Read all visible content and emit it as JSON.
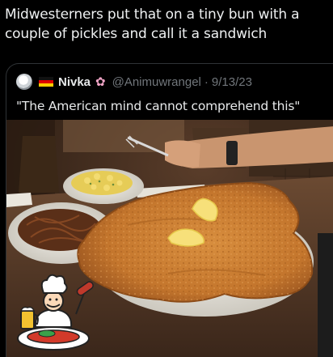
{
  "post": {
    "text": "Midwesterners put that on a tiny bun with a couple of pickles and call it a sandwich"
  },
  "quote": {
    "author_name": "Nivka",
    "handle": "@Animuwrangel",
    "separator": "·",
    "date": "9/13/23",
    "text": "\"The American mind cannot comprehend this\""
  },
  "icons": {
    "avatar": "avatar-image",
    "flag": "german-flag-icon",
    "flower": "cherry-blossom-icon",
    "logo": "chef-restaurant-logo"
  },
  "colors": {
    "background": "#000000",
    "muted_text": "#71767b",
    "primary_text": "#e7e9ea",
    "card_border": "#2f3336"
  }
}
